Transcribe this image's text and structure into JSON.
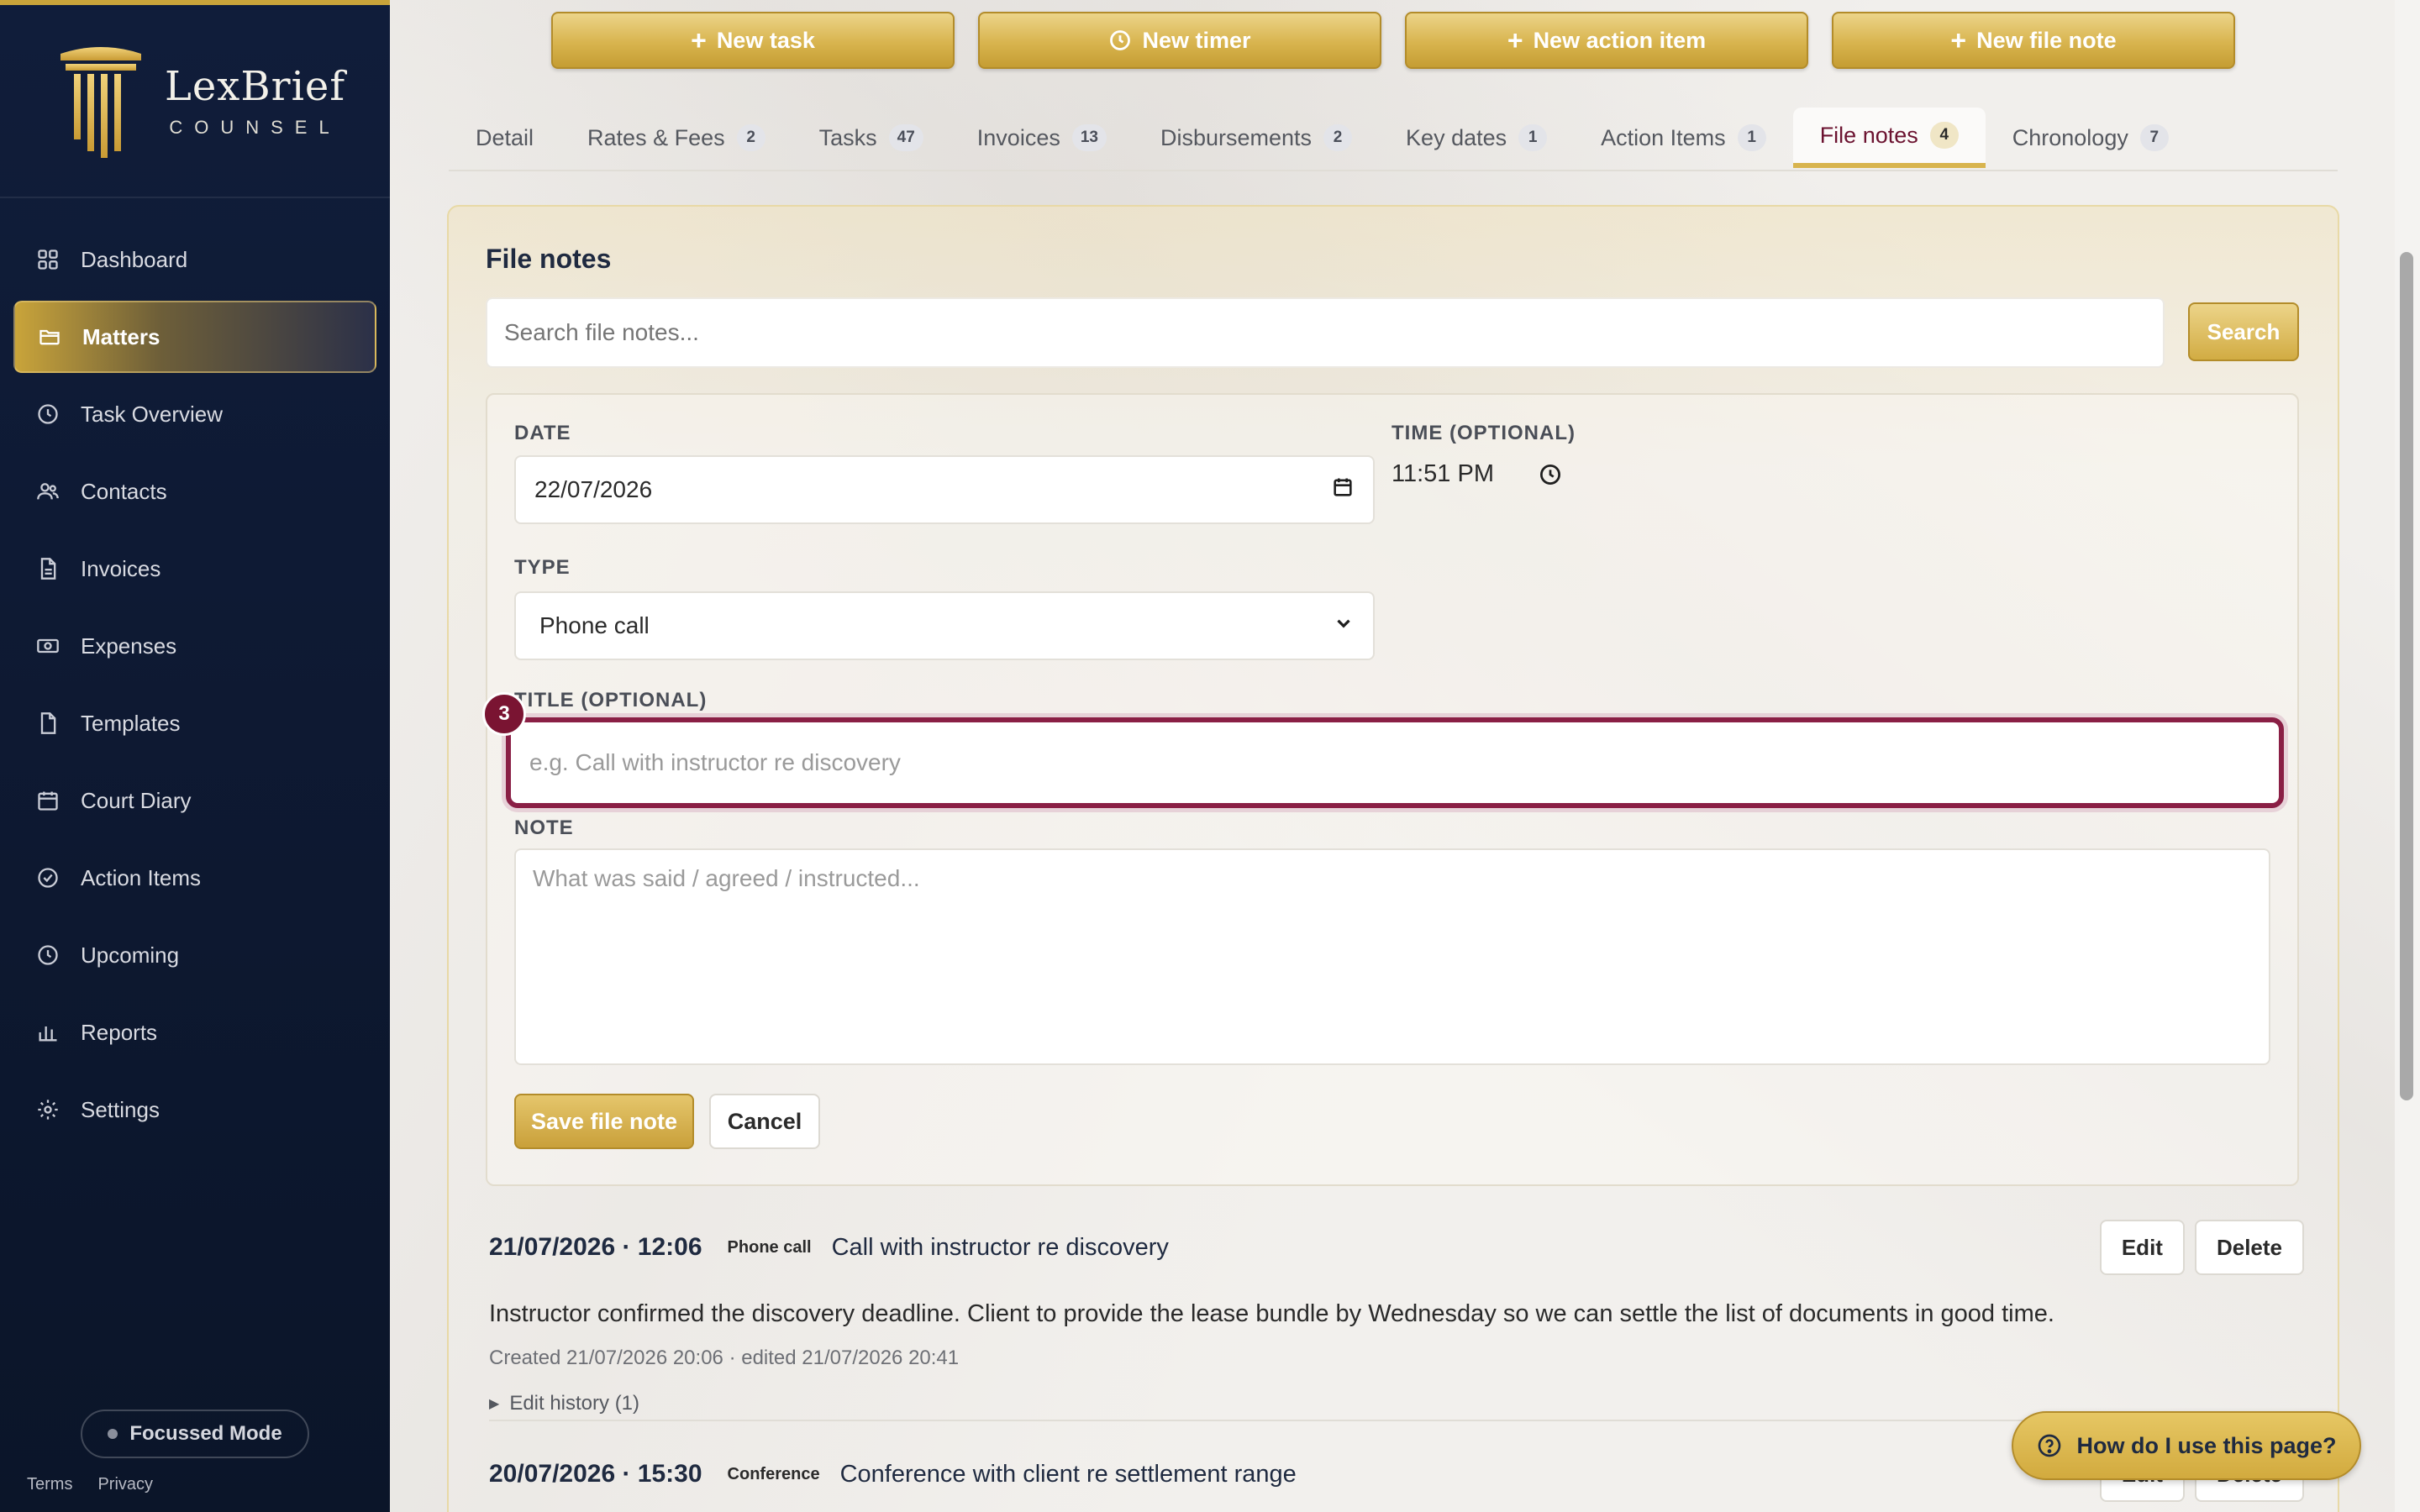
{
  "brand": {
    "name": "LexBrief",
    "sub": "COUNSEL"
  },
  "sidebar": {
    "items": [
      {
        "label": "Dashboard",
        "icon": "grid-icon",
        "active": false
      },
      {
        "label": "Matters",
        "icon": "folder-icon",
        "active": true
      },
      {
        "label": "Task Overview",
        "icon": "clock-icon",
        "active": false
      },
      {
        "label": "Contacts",
        "icon": "users-icon",
        "active": false
      },
      {
        "label": "Invoices",
        "icon": "document-icon",
        "active": false
      },
      {
        "label": "Expenses",
        "icon": "money-icon",
        "active": false
      },
      {
        "label": "Templates",
        "icon": "file-icon",
        "active": false
      },
      {
        "label": "Court Diary",
        "icon": "calendar-icon",
        "active": false
      },
      {
        "label": "Action Items",
        "icon": "check-circle-icon",
        "active": false
      },
      {
        "label": "Upcoming",
        "icon": "clock-icon",
        "active": false
      },
      {
        "label": "Reports",
        "icon": "bar-chart-icon",
        "active": false
      },
      {
        "label": "Settings",
        "icon": "gear-icon",
        "active": false
      }
    ],
    "focus_mode": "Focussed Mode",
    "footer": {
      "terms": "Terms",
      "privacy": "Privacy"
    }
  },
  "actions": {
    "new_task": "New task",
    "new_timer": "New timer",
    "new_action_item": "New action item",
    "new_file_note": "New file note"
  },
  "tabs": [
    {
      "label": "Detail",
      "count": ""
    },
    {
      "label": "Rates & Fees",
      "count": "2"
    },
    {
      "label": "Tasks",
      "count": "47"
    },
    {
      "label": "Invoices",
      "count": "13"
    },
    {
      "label": "Disbursements",
      "count": "2"
    },
    {
      "label": "Key dates",
      "count": "1"
    },
    {
      "label": "Action Items",
      "count": "1"
    },
    {
      "label": "File notes",
      "count": "4"
    },
    {
      "label": "Chronology",
      "count": "7"
    }
  ],
  "file_notes": {
    "title": "File notes",
    "search_placeholder": "Search file notes...",
    "search_button": "Search",
    "form": {
      "date_label": "DATE",
      "date_value": "22/07/2026",
      "time_label": "TIME (OPTIONAL)",
      "time_value": "11:51 PM",
      "type_label": "TYPE",
      "type_value": "Phone call",
      "title_label": "TITLE (OPTIONAL)",
      "title_placeholder": "e.g. Call with instructor re discovery",
      "step_number": "3",
      "note_label": "NOTE",
      "note_placeholder": "What was said / agreed / instructed...",
      "save_button": "Save file note",
      "cancel_button": "Cancel"
    },
    "entries": [
      {
        "date": "21/07/2026 · 12:06",
        "type": "Phone call",
        "title": "Call with instructor re discovery",
        "body": "Instructor confirmed the discovery deadline. Client to provide the lease bundle by Wednesday so we can settle the list of documents in good time.",
        "meta": "Created 21/07/2026 20:06 · edited 21/07/2026 20:41",
        "history": "Edit history (1)",
        "edit": "Edit",
        "delete": "Delete"
      },
      {
        "date": "20/07/2026 · 15:30",
        "type": "Conference",
        "title": "Conference with client re settlement range",
        "edit": "Edit",
        "delete": "Delete"
      }
    ]
  },
  "help": {
    "label": "How do I use this page?"
  },
  "colors": {
    "gold": "#d8b44e",
    "navy": "#101d3a",
    "maroon": "#7a1432"
  }
}
